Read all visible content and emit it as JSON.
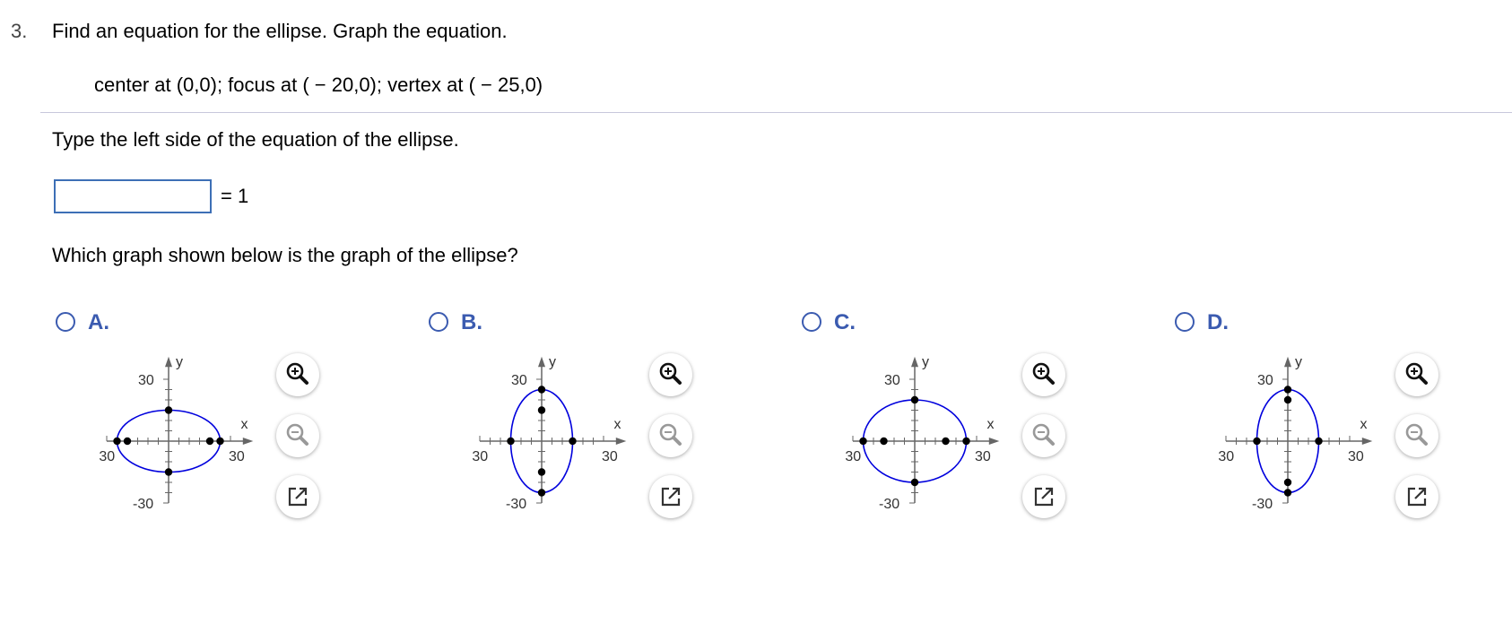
{
  "question": {
    "number": "3.",
    "text": "Find an equation for the ellipse.  Graph the equation.",
    "given": "center at (0,0); focus at ( − 20,0); vertex at ( − 25,0)"
  },
  "part1": {
    "prompt": "Type the left side of the equation of the ellipse.",
    "answer_value": "",
    "rhs": "= 1"
  },
  "part2": {
    "prompt": "Which graph shown below is the graph of the ellipse?"
  },
  "axis": {
    "x_label": "x",
    "y_label": "y",
    "x_min_label": "-30",
    "x_max_label": "30",
    "y_max_label": "30",
    "y_min_label": "-30",
    "range": [
      -30,
      30
    ]
  },
  "options": [
    {
      "label": "A.",
      "ellipse": {
        "a": 25,
        "b": 15
      },
      "points": [
        [
          -25,
          0
        ],
        [
          25,
          0
        ],
        [
          -20,
          0
        ],
        [
          20,
          0
        ],
        [
          0,
          15
        ],
        [
          0,
          -15
        ]
      ]
    },
    {
      "label": "B.",
      "ellipse": {
        "a": 15,
        "b": 25
      },
      "points": [
        [
          0,
          25
        ],
        [
          0,
          -25
        ],
        [
          0,
          15
        ],
        [
          0,
          -15
        ],
        [
          -15,
          0
        ],
        [
          15,
          0
        ]
      ]
    },
    {
      "label": "C.",
      "ellipse": {
        "a": 25,
        "b": 20
      },
      "points": [
        [
          -25,
          0
        ],
        [
          25,
          0
        ],
        [
          -15,
          0
        ],
        [
          15,
          0
        ],
        [
          0,
          20
        ],
        [
          0,
          -20
        ]
      ]
    },
    {
      "label": "D.",
      "ellipse": {
        "a": 15,
        "b": 25
      },
      "points": [
        [
          0,
          25
        ],
        [
          0,
          -25
        ],
        [
          0,
          20
        ],
        [
          0,
          -20
        ],
        [
          -15,
          0
        ],
        [
          15,
          0
        ]
      ]
    }
  ],
  "colors": {
    "ellipse": "#0000dd",
    "accent": "#3b5bb0",
    "axis": "#666666"
  },
  "tools": [
    "zoom-in-icon",
    "zoom-out-icon",
    "popout-icon"
  ]
}
